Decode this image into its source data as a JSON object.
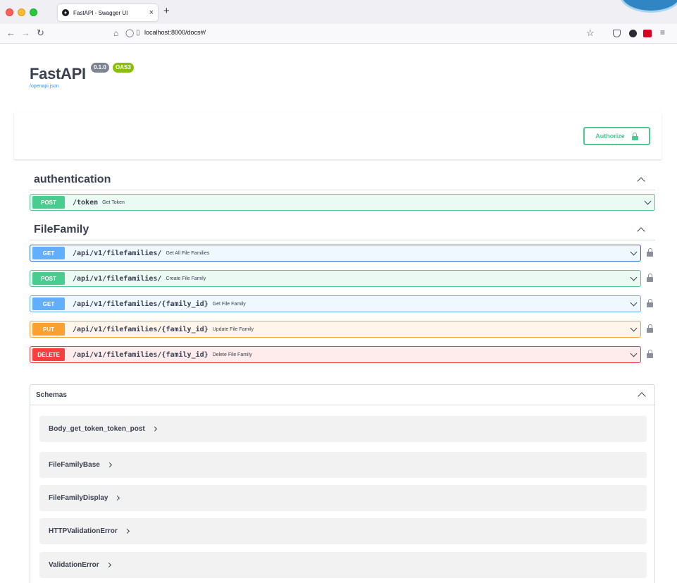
{
  "browser": {
    "tab_title": "FastAPI - Swagger UI",
    "tab_close": "×",
    "new_tab": "+",
    "url": "localhost:8000/docs#/",
    "icons": [
      "back-icon",
      "forward-icon",
      "reload-icon",
      "home-icon",
      "shield-icon",
      "page-icon",
      "bookmark-star-icon",
      "pocket-icon",
      "extension-icon",
      "extension-red-icon",
      "menu-icon"
    ]
  },
  "info": {
    "title": "FastAPI",
    "version": "0.1.0",
    "oas": "OAS3",
    "openapi_link": "/openapi.json"
  },
  "authorize": {
    "label": "Authorize"
  },
  "tags": [
    {
      "name": "authentication",
      "operations": [
        {
          "method": "POST",
          "path": "/token",
          "summary": "Get Token",
          "locked": false
        }
      ]
    },
    {
      "name": "FileFamily",
      "operations": [
        {
          "method": "GET",
          "path": "/api/v1/filefamilies/",
          "summary": "Get All File Families",
          "locked": true
        },
        {
          "method": "POST",
          "path": "/api/v1/filefamilies/",
          "summary": "Create File Family",
          "locked": true
        },
        {
          "method": "GET",
          "path": "/api/v1/filefamilies/{family_id}",
          "summary": "Get File Family",
          "locked": true
        },
        {
          "method": "PUT",
          "path": "/api/v1/filefamilies/{family_id}",
          "summary": "Update File Family",
          "locked": true
        },
        {
          "method": "DELETE",
          "path": "/api/v1/filefamilies/{family_id}",
          "summary": "Delete File Family",
          "locked": true
        }
      ]
    }
  ],
  "schemas": {
    "title": "Schemas",
    "items": [
      "Body_get_token_token_post",
      "FileFamilyBase",
      "FileFamilyDisplay",
      "HTTPValidationError",
      "ValidationError"
    ]
  },
  "colors": {
    "post": "#49cc90",
    "get": "#61affe",
    "put": "#fca130",
    "delete": "#f93e3e",
    "text": "#3b4151",
    "link": "#4990e2"
  }
}
